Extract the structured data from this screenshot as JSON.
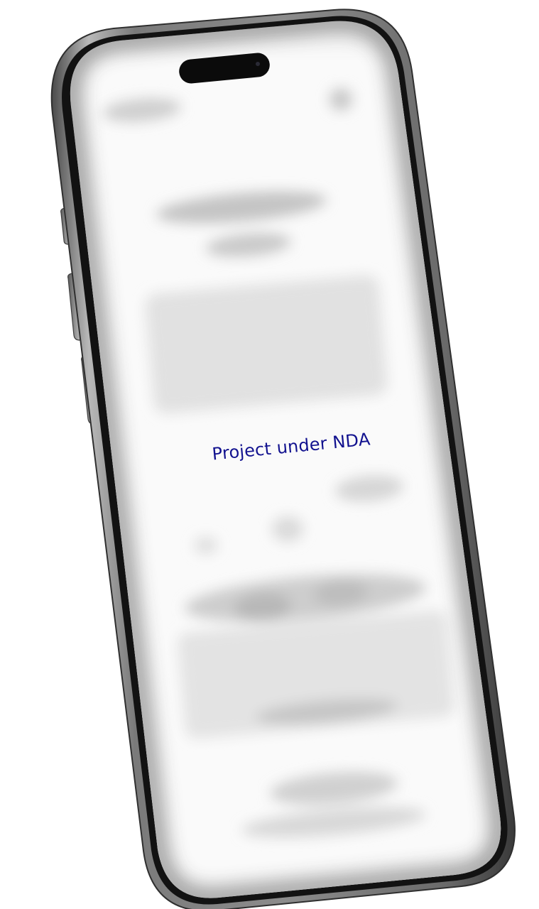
{
  "screen": {
    "message": "Project under NDA",
    "message_color": "#12128f",
    "content_state": "blurred"
  },
  "device": {
    "type": "smartphone",
    "frame_color": "#6e6e6e"
  }
}
